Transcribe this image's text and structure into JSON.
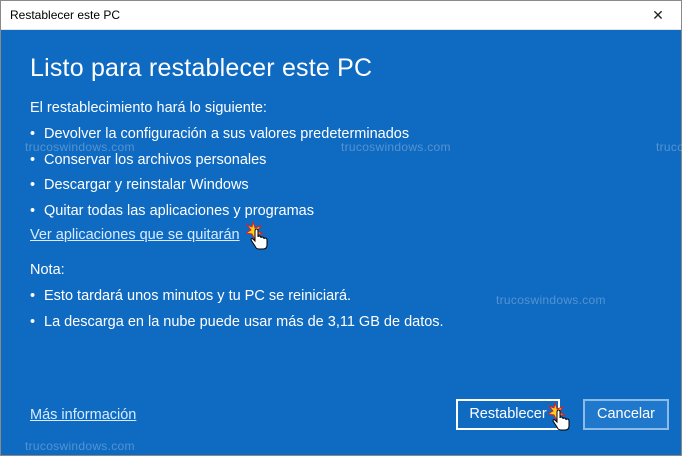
{
  "window": {
    "title": "Restablecer este PC",
    "close_glyph": "✕"
  },
  "content": {
    "heading": "Listo para restablecer este PC",
    "intro": "El restablecimiento hará lo siguiente:",
    "bullet_glyph": "•",
    "bullets": [
      "Devolver la configuración a sus valores predeterminados",
      "Conservar los archivos personales",
      "Descargar y reinstalar Windows",
      "Quitar todas las aplicaciones y programas"
    ],
    "apps_link": "Ver aplicaciones que se quitarán",
    "note_label": "Nota:",
    "notes": [
      "Esto tardará unos minutos y tu PC se reiniciará.",
      "La descarga en la nube puede usar más de 3,11 GB de datos."
    ],
    "more_info_link": "Más información"
  },
  "buttons": {
    "reset": "Restablecer",
    "cancel": "Cancelar"
  },
  "watermark": {
    "text": "trucoswindows.com"
  },
  "colors": {
    "background": "#0f6ac1",
    "link": "#d7ecff",
    "text": "#ffffff"
  },
  "icons": {
    "cursor": "hand-pointer-click-icon",
    "close": "close-icon"
  }
}
